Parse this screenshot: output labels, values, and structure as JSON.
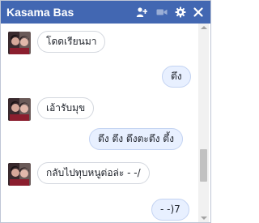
{
  "header": {
    "title": "Kasama Bas",
    "icons": [
      "add-friend-icon",
      "video-call-icon",
      "gear-icon",
      "close-icon"
    ],
    "bg_color": "#4267b2"
  },
  "messages": [
    {
      "direction": "incoming",
      "text": "โดดเรียนมา"
    },
    {
      "direction": "outgoing",
      "text": "ตึง"
    },
    {
      "direction": "incoming",
      "text": "เอ้ารับมุข"
    },
    {
      "direction": "outgoing",
      "text": "ตึง ตึง ตึงตะตึง ตึ้ง"
    },
    {
      "direction": "incoming",
      "text": "กลับไปทุบหนูต่อล่ะ - -/"
    },
    {
      "direction": "outgoing",
      "text": "- -)7"
    }
  ],
  "colors": {
    "incoming_bubble": "#ffffff",
    "outgoing_bubble": "#e8f0ff"
  }
}
